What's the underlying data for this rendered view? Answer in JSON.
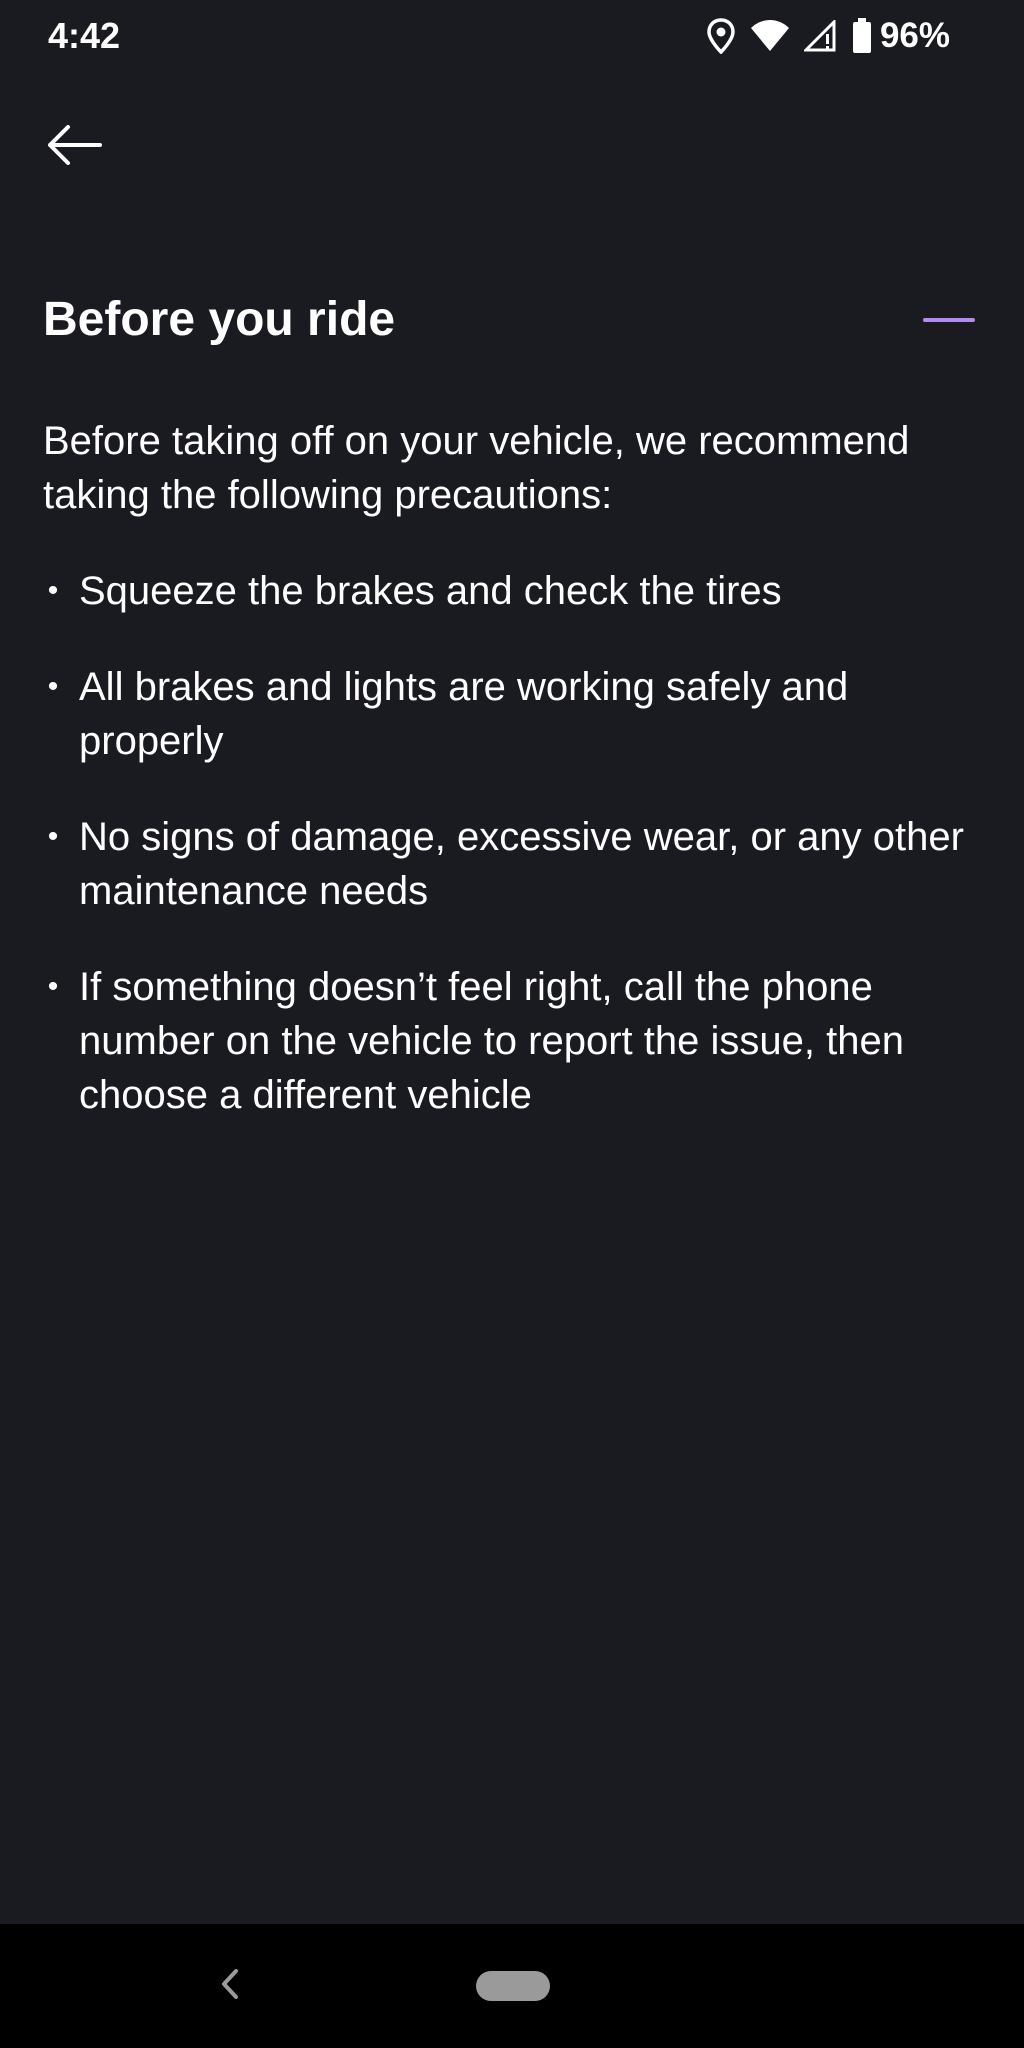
{
  "status_bar": {
    "time": "4:42",
    "battery_percent": "96%",
    "icons": [
      "location-icon",
      "wifi-icon",
      "cellular-signal-icon",
      "battery-icon"
    ]
  },
  "header": {
    "back_icon": "arrow-left-icon"
  },
  "section": {
    "title": "Before you ride",
    "expanded": true,
    "collapse_icon": "minus-icon",
    "intro": "Before taking off on your vehicle, we recommend taking the following precautions:",
    "items": [
      "Squeeze the brakes and check the tires",
      "All brakes and lights are working safely and properly",
      "No signs of damage, excessive wear, or any other maintenance needs",
      "If something doesn’t feel right, call the phone number on the vehicle to report the issue, then choose a different vehicle"
    ],
    "bullet": "•"
  },
  "nav_bar": {
    "back_icon": "chevron-left-icon",
    "home_icon": "home-pill-icon"
  },
  "colors": {
    "background": "#1a1a21",
    "accent": "#b38cf0",
    "text": "#ffffff",
    "nav_background": "#000000"
  }
}
